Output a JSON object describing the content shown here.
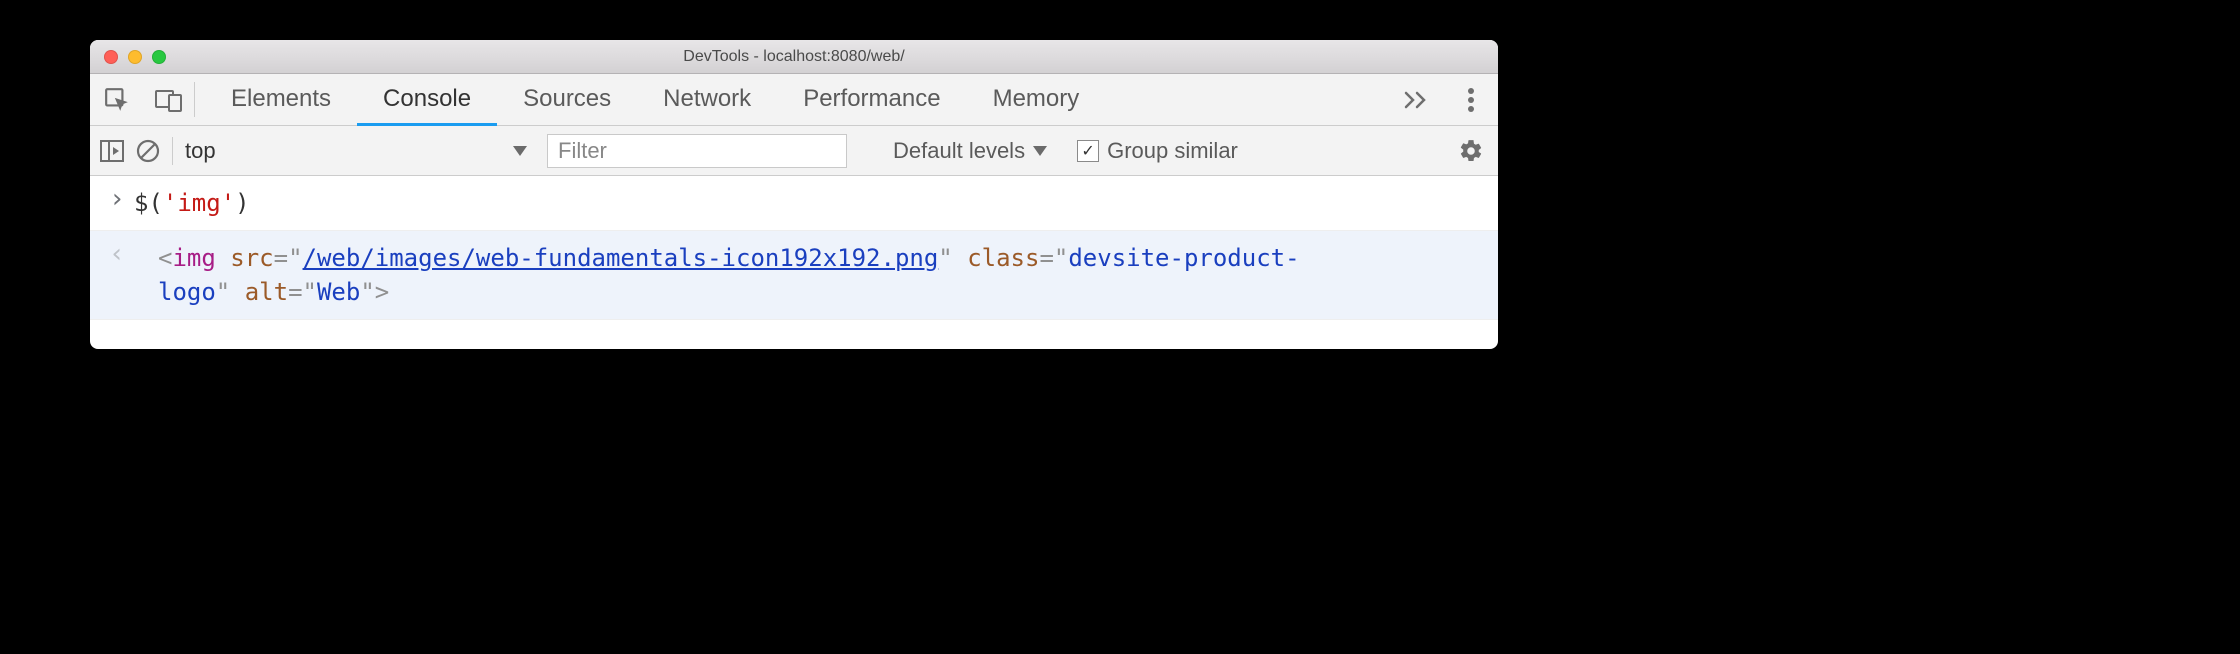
{
  "window": {
    "title": "DevTools - localhost:8080/web/"
  },
  "tabs": {
    "items": [
      "Elements",
      "Console",
      "Sources",
      "Network",
      "Performance",
      "Memory"
    ],
    "activeIndex": 1
  },
  "toolbar": {
    "context": "top",
    "filter_placeholder": "Filter",
    "levels_label": "Default levels",
    "group_similar_label": "Group similar",
    "group_similar_checked": true
  },
  "console": {
    "input": {
      "fn": "$",
      "open": "(",
      "arg": "'img'",
      "close": ")"
    },
    "output": {
      "lt": "<",
      "tag": "img",
      "sp": " ",
      "attr_src": "src",
      "eq": "=\"",
      "src_val": "/web/images/web-fundamentals-icon192x192.png",
      "q": "\"",
      "attr_class": "class",
      "class_val": "devsite-product-logo",
      "attr_alt": "alt",
      "alt_val": "Web",
      "gt": ">"
    }
  }
}
